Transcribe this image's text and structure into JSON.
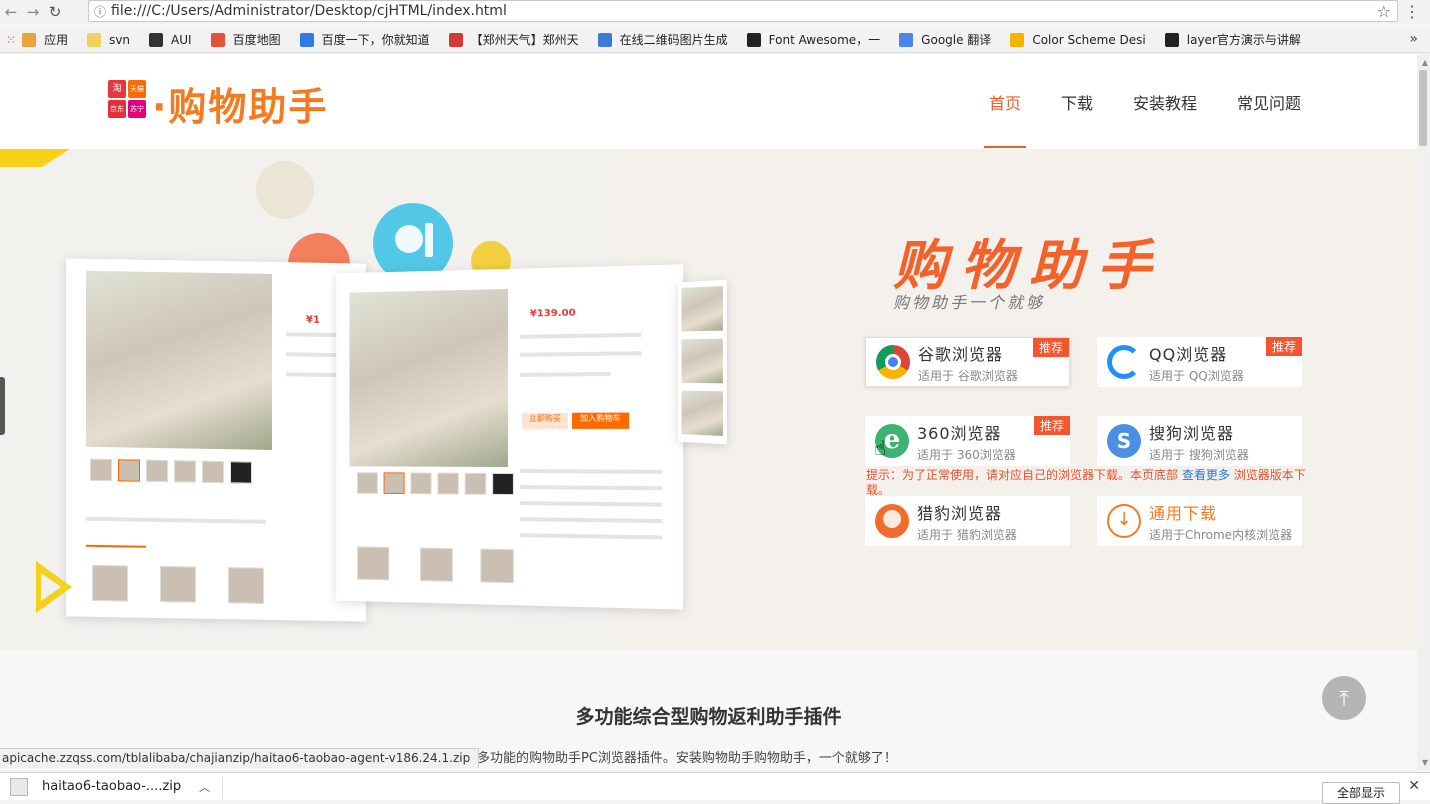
{
  "browser": {
    "url": "file:///C:/Users/Administrator/Desktop/cjHTML/index.html",
    "bookmarks": [
      {
        "label": "应用",
        "color": "#e8a33d"
      },
      {
        "label": "svn",
        "color": "#f3d15c"
      },
      {
        "label": "AUI",
        "color": "#333333"
      },
      {
        "label": "百度地图",
        "color": "#e5523a"
      },
      {
        "label": "百度一下，你就知道",
        "color": "#2f7be5"
      },
      {
        "label": "【郑州天气】郑州天",
        "color": "#d23a3a"
      },
      {
        "label": "在线二维码图片生成",
        "color": "#3a7bd5"
      },
      {
        "label": "Font Awesome，一",
        "color": "#222222"
      },
      {
        "label": "Google 翻译",
        "color": "#4a86e8"
      },
      {
        "label": "Color Scheme Desi",
        "color": "#f4b400"
      },
      {
        "label": "layer官方演示与讲解",
        "color": "#222222"
      }
    ],
    "more_symbol": "»"
  },
  "site": {
    "logo_text": "·购物助手",
    "logo_tiles": [
      "淘",
      "天猫",
      "京东",
      "苏宁"
    ],
    "nav": [
      {
        "label": "首页",
        "active": true
      },
      {
        "label": "下载",
        "active": false
      },
      {
        "label": "安装教程",
        "active": false
      },
      {
        "label": "常见问题",
        "active": false
      }
    ]
  },
  "hero": {
    "title": "购物助手",
    "subtitle": "购物助手一个就够",
    "mock_price": "¥139.00",
    "mock_price_small": "¥1",
    "mock_buy": "立即购买",
    "mock_cart": "加入购物车",
    "downloads": [
      {
        "name": "谷歌浏览器",
        "sub": "适用于 谷歌浏览器",
        "badge": "推荐",
        "icon": "chrome-icon",
        "color": "#db4437"
      },
      {
        "name": "QQ浏览器",
        "sub": "适用于 QQ浏览器",
        "badge": "推荐",
        "icon": "qq-browser-icon",
        "color": "#1e90ff"
      },
      {
        "name": "360浏览器",
        "sub": "适用于 360浏览器",
        "badge": "推荐",
        "icon": "360-browser-icon",
        "color": "#3cb371"
      },
      {
        "name": "搜狗浏览器",
        "sub": "适用于 搜狗浏览器",
        "badge": "",
        "icon": "sogou-browser-icon",
        "color": "#4a8fe0"
      },
      {
        "name": "猎豹浏览器",
        "sub": "适用于 猎豹浏览器",
        "badge": "",
        "icon": "liebao-browser-icon",
        "color": "#f26b2a"
      },
      {
        "name": "通用下载",
        "sub": "适用于Chrome内核浏览器",
        "badge": "",
        "icon": "download-icon",
        "color": "#f47b20"
      }
    ],
    "hint_prefix": "提示：为了正常使用，请对应自己的浏览器下载。本页底部",
    "hint_link": "查看更多",
    "hint_suffix": "浏览器版本下载。"
  },
  "section": {
    "title": "多功能综合型购物返利助手插件",
    "desc": "最方便、最实用、多功能的购物助手PC浏览器插件。安装购物助手购物助手，一个就够了！"
  },
  "status_url": "apicache.zzqss.com/tblalibaba/chajianzip/haitao6-taobao-agent-v186.24.1.zip",
  "download_shelf": {
    "file_name": "haitao6-taobao-....zip",
    "show_all": "全部显示"
  }
}
